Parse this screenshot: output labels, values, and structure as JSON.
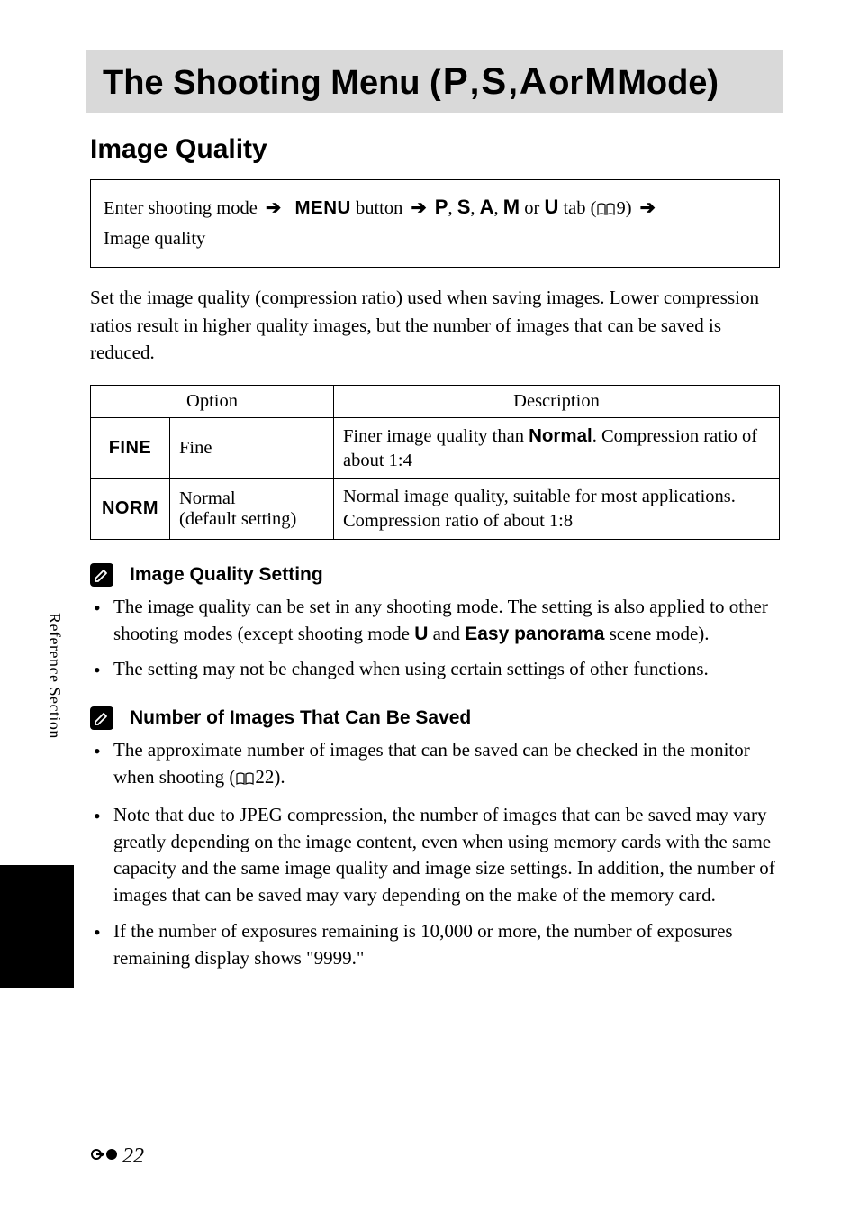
{
  "title_banner": {
    "text_before": "The Shooting Menu (",
    "modes": [
      "P",
      "S",
      "A",
      "M"
    ],
    "separator_comma": ", ",
    "separator_or": " or ",
    "text_after": " Mode)"
  },
  "section_heading": "Image Quality",
  "nav_box": {
    "enter_text": "Enter shooting mode ",
    "arrow": "➔",
    "menu_word": "MENU",
    "button_text": " button ",
    "modes": [
      "P",
      "S",
      "A",
      "M",
      "U"
    ],
    "tab_text_before": " tab (",
    "page_ref": "9",
    "tab_text_after": ") ",
    "line2": "Image quality"
  },
  "body_paragraph": "Set the image quality (compression ratio) used when saving images. Lower compression ratios result in higher quality images, but the number of images that can be saved is reduced.",
  "table": {
    "headers": {
      "option": "Option",
      "description": "Description"
    },
    "rows": [
      {
        "icon": "FINE",
        "name": "Fine",
        "desc_before": "Finer image quality than ",
        "desc_bold": "Normal",
        "desc_after": ". Compression ratio of about 1:4"
      },
      {
        "icon": "NORM",
        "name_line1": "Normal",
        "name_line2": "(default setting)",
        "desc": "Normal image quality, suitable for most applications. Compression ratio of about 1:8"
      }
    ]
  },
  "note1": {
    "title": "Image Quality Setting",
    "bullets": [
      {
        "parts": [
          {
            "t": "text",
            "v": "The image quality can be set in any shooting mode. The setting is also applied to other shooting modes (except shooting mode "
          },
          {
            "t": "mode",
            "v": "U"
          },
          {
            "t": "text",
            "v": " and "
          },
          {
            "t": "bold",
            "v": "Easy panorama"
          },
          {
            "t": "text",
            "v": " scene mode)."
          }
        ]
      },
      {
        "parts": [
          {
            "t": "text",
            "v": "The setting may not be changed when using certain settings of other functions."
          }
        ]
      }
    ]
  },
  "note2": {
    "title": "Number of Images That Can Be Saved",
    "bullets": [
      {
        "parts": [
          {
            "t": "text",
            "v": "The approximate number of images that can be saved can be checked in the monitor when shooting ("
          },
          {
            "t": "book",
            "v": ""
          },
          {
            "t": "text",
            "v": "22)."
          }
        ]
      },
      {
        "parts": [
          {
            "t": "text",
            "v": "Note that due to JPEG compression, the number of images that can be saved may vary greatly depending on the image content, even when using memory cards with the same capacity and the same image quality and image size settings. In addition, the number of images that can be saved may vary depending on the make of the memory card."
          }
        ]
      },
      {
        "parts": [
          {
            "t": "text",
            "v": "If the number of exposures remaining is 10,000 or more, the number of exposures remaining display shows \"9999.\""
          }
        ]
      }
    ]
  },
  "side_label": "Reference Section",
  "page_number": "22"
}
